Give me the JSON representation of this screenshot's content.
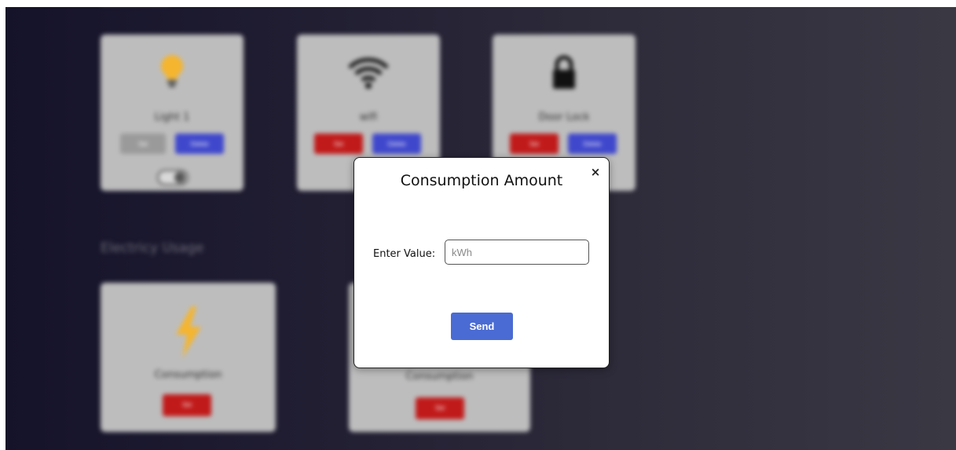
{
  "background": {
    "devices": [
      {
        "name": "Light 1",
        "icon": "lightbulb-icon",
        "buttons": [
          "Set",
          "Delete"
        ]
      },
      {
        "name": "wifi",
        "icon": "wifi-icon",
        "buttons": [
          "Set",
          "Delete"
        ]
      },
      {
        "name": "Door Lock",
        "icon": "lock-icon",
        "buttons": [
          "Set",
          "Delete"
        ]
      }
    ],
    "electricity_section_title": "Electricy Usage",
    "usage_cards": [
      {
        "name": "Consumption",
        "icon": "lightning-bolt-icon",
        "button": "Set"
      },
      {
        "name": "Consumption",
        "icon": "water-drop-icon",
        "button": "Set"
      }
    ]
  },
  "modal": {
    "title": "Consumption Amount",
    "close_label": "×",
    "field_label": "Enter Value:",
    "field_placeholder": "kWh",
    "field_value": "",
    "submit_label": "Send"
  },
  "colors": {
    "accent_blue": "#4a6bd3",
    "danger_red": "#c11a1a",
    "bulb_yellow": "#f5b52e"
  }
}
